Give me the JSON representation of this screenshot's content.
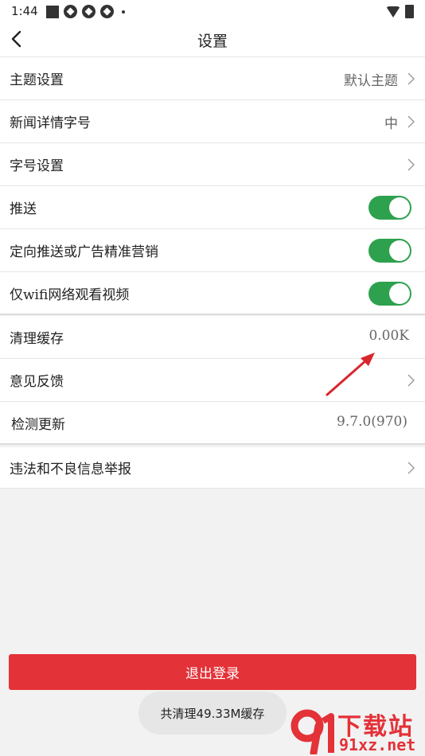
{
  "status_bar": {
    "time": "1:44"
  },
  "nav": {
    "title": "设置"
  },
  "settings": {
    "theme": {
      "label": "主题设置",
      "value": "默认主题"
    },
    "news_font_size": {
      "label": "新闻详情字号",
      "value": "中"
    },
    "font_settings": {
      "label": "字号设置"
    },
    "push": {
      "label": "推送",
      "enabled": true
    },
    "targeted_ads": {
      "label": "定向推送或广告精准营销",
      "enabled": true
    },
    "wifi_only_video": {
      "label": "仅wifi网络观看视频",
      "enabled": true
    },
    "clear_cache": {
      "label": "清理缓存",
      "value": "0.00K"
    },
    "feedback": {
      "label": "意见反馈"
    },
    "check_update": {
      "label": "检测更新",
      "value": "9.7.0(970)"
    },
    "report": {
      "label": "违法和不良信息举报"
    }
  },
  "logout": {
    "label": "退出登录"
  },
  "toast": {
    "text": "共清理49.33M缓存"
  },
  "watermark": {
    "title": "下载站",
    "url": "91xz.net"
  },
  "colors": {
    "accent_red": "#e33238",
    "toggle_green": "#2ea14e"
  }
}
